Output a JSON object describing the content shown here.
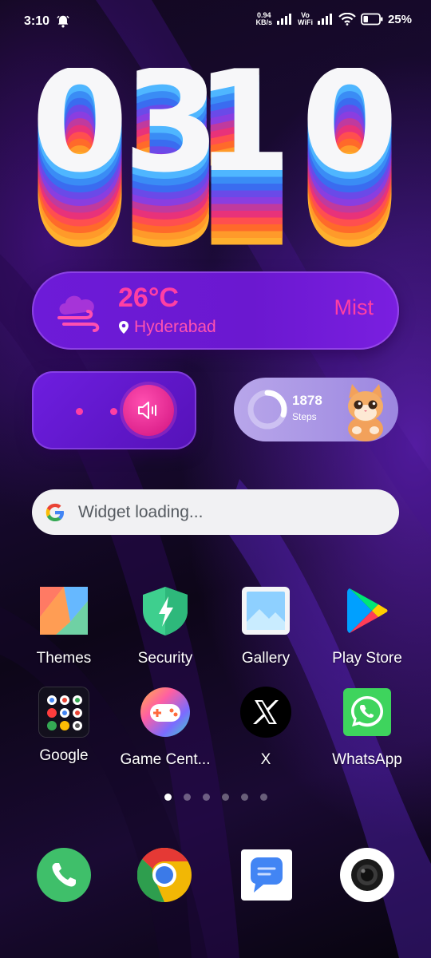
{
  "status_bar": {
    "time": "3:10",
    "net_speed_value": "0.94",
    "net_speed_unit": "KB/s",
    "vo": "Vo",
    "wifi_label": "WiFi",
    "battery": "25%"
  },
  "clock": {
    "digits": [
      "0",
      "3",
      "1",
      "0"
    ]
  },
  "weather": {
    "temperature": "26°C",
    "city": "Hyderabad",
    "condition": "Mist"
  },
  "steps": {
    "count": "1878",
    "label": "Steps",
    "progress_fraction": 0.3
  },
  "search": {
    "placeholder": "Widget loading..."
  },
  "apps": [
    {
      "label": "Themes",
      "icon": "themes-icon"
    },
    {
      "label": "Security",
      "icon": "security-icon"
    },
    {
      "label": "Gallery",
      "icon": "gallery-icon"
    },
    {
      "label": "Play Store",
      "icon": "play-store-icon"
    },
    {
      "label": "Google",
      "icon": "google-folder-icon"
    },
    {
      "label": "Game Cent...",
      "icon": "game-center-icon"
    },
    {
      "label": "X",
      "icon": "x-icon"
    },
    {
      "label": "WhatsApp",
      "icon": "whatsapp-icon"
    }
  ],
  "page_indicator": {
    "count": 6,
    "active": 0
  },
  "dock": [
    {
      "icon": "phone-icon"
    },
    {
      "icon": "chrome-icon"
    },
    {
      "icon": "messages-icon"
    },
    {
      "icon": "camera-icon"
    }
  ],
  "colors": {
    "accent_pink": "#ff3fa3",
    "widget_purple": "#6d1bd8",
    "steps_lavender": "#b8a6ea"
  }
}
